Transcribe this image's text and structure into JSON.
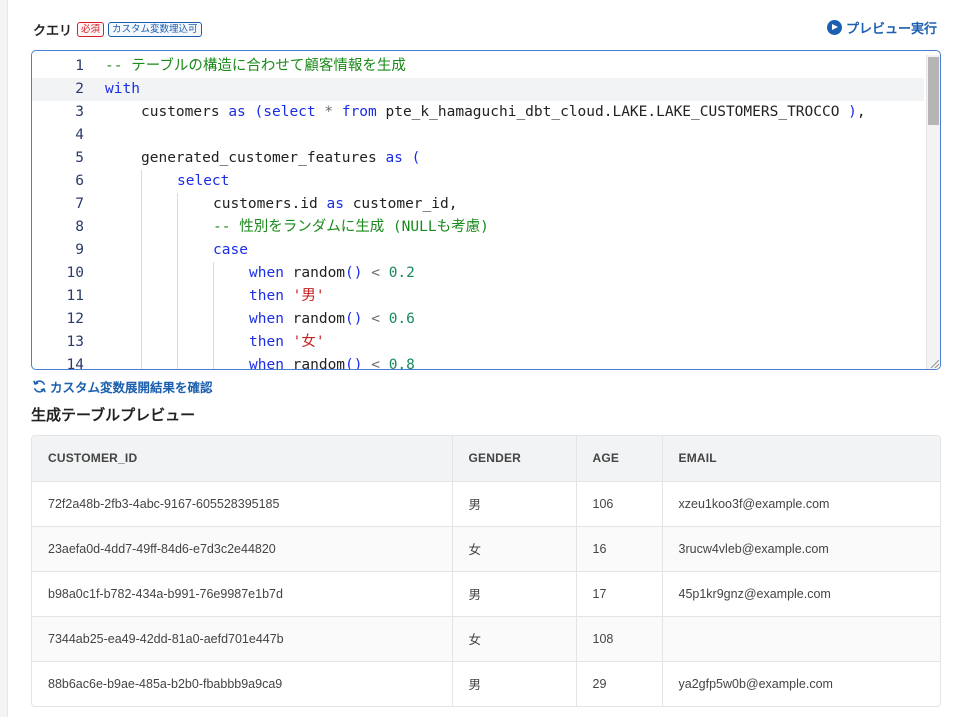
{
  "query": {
    "title": "クエリ",
    "badge_required": "必須",
    "badge_custom_vars": "カスタム変数埋込可",
    "preview_run_label": "プレビュー実行"
  },
  "editor": {
    "active_line": 2,
    "lines": [
      {
        "no": "1",
        "indent": 0,
        "tokens": [
          {
            "t": "cm",
            "v": "-- テーブルの構造に合わせて顧客情報を生成"
          }
        ]
      },
      {
        "no": "2",
        "indent": 0,
        "tokens": [
          {
            "t": "kw",
            "v": "with"
          }
        ]
      },
      {
        "no": "3",
        "indent": 1,
        "tokens": [
          {
            "t": "tx",
            "v": "customers "
          },
          {
            "t": "kw",
            "v": "as"
          },
          {
            "t": "tx",
            "v": " "
          },
          {
            "t": "par",
            "v": "("
          },
          {
            "t": "kw",
            "v": "select"
          },
          {
            "t": "tx",
            "v": " "
          },
          {
            "t": "op",
            "v": "*"
          },
          {
            "t": "tx",
            "v": " "
          },
          {
            "t": "kw",
            "v": "from"
          },
          {
            "t": "tx",
            "v": " pte_k_hamaguchi_dbt_cloud.LAKE.LAKE_CUSTOMERS_TROCCO "
          },
          {
            "t": "par",
            "v": ")"
          },
          {
            "t": "tx",
            "v": ","
          }
        ]
      },
      {
        "no": "4",
        "indent": 0,
        "tokens": []
      },
      {
        "no": "5",
        "indent": 1,
        "tokens": [
          {
            "t": "tx",
            "v": "generated_customer_features "
          },
          {
            "t": "kw",
            "v": "as"
          },
          {
            "t": "tx",
            "v": " "
          },
          {
            "t": "par",
            "v": "("
          }
        ]
      },
      {
        "no": "6",
        "indent": 2,
        "tokens": [
          {
            "t": "kw",
            "v": "select"
          }
        ]
      },
      {
        "no": "7",
        "indent": 3,
        "tokens": [
          {
            "t": "tx",
            "v": "customers.id "
          },
          {
            "t": "kw",
            "v": "as"
          },
          {
            "t": "tx",
            "v": " customer_id,"
          }
        ]
      },
      {
        "no": "8",
        "indent": 3,
        "tokens": [
          {
            "t": "cm",
            "v": "-- 性別をランダムに生成 (NULLも考慮)"
          }
        ]
      },
      {
        "no": "9",
        "indent": 3,
        "tokens": [
          {
            "t": "kw",
            "v": "case"
          }
        ]
      },
      {
        "no": "10",
        "indent": 4,
        "tokens": [
          {
            "t": "kw",
            "v": "when"
          },
          {
            "t": "tx",
            "v": " random"
          },
          {
            "t": "par",
            "v": "()"
          },
          {
            "t": "tx",
            "v": " "
          },
          {
            "t": "op",
            "v": "<"
          },
          {
            "t": "tx",
            "v": " "
          },
          {
            "t": "num",
            "v": "0.2"
          }
        ]
      },
      {
        "no": "11",
        "indent": 4,
        "tokens": [
          {
            "t": "kw",
            "v": "then"
          },
          {
            "t": "tx",
            "v": " "
          },
          {
            "t": "str",
            "v": "'男'"
          }
        ]
      },
      {
        "no": "12",
        "indent": 4,
        "tokens": [
          {
            "t": "kw",
            "v": "when"
          },
          {
            "t": "tx",
            "v": " random"
          },
          {
            "t": "par",
            "v": "()"
          },
          {
            "t": "tx",
            "v": " "
          },
          {
            "t": "op",
            "v": "<"
          },
          {
            "t": "tx",
            "v": " "
          },
          {
            "t": "num",
            "v": "0.6"
          }
        ]
      },
      {
        "no": "13",
        "indent": 4,
        "tokens": [
          {
            "t": "kw",
            "v": "then"
          },
          {
            "t": "tx",
            "v": " "
          },
          {
            "t": "str",
            "v": "'女'"
          }
        ]
      },
      {
        "no": "14",
        "indent": 4,
        "tokens": [
          {
            "t": "kw",
            "v": "when"
          },
          {
            "t": "tx",
            "v": " random"
          },
          {
            "t": "par",
            "v": "()"
          },
          {
            "t": "tx",
            "v": " "
          },
          {
            "t": "op",
            "v": "<"
          },
          {
            "t": "tx",
            "v": " "
          },
          {
            "t": "num",
            "v": "0.8"
          }
        ]
      }
    ]
  },
  "check_link_label": "カスタム変数展開結果を確認",
  "preview_section_title": "生成テーブルプレビュー",
  "preview_table": {
    "columns": [
      "CUSTOMER_ID",
      "GENDER",
      "AGE",
      "EMAIL"
    ],
    "rows": [
      [
        "72f2a48b-2fb3-4abc-9167-605528395185",
        "男",
        "106",
        "xzeu1koo3f@example.com"
      ],
      [
        "23aefa0d-4dd7-49ff-84d6-e7d3c2e44820",
        "女",
        "16",
        "3rucw4vleb@example.com"
      ],
      [
        "b98a0c1f-b782-434a-b991-76e9987e1b7d",
        "男",
        "17",
        "45p1kr9gnz@example.com"
      ],
      [
        "7344ab25-ea49-42dd-81a0-aefd701e447b",
        "女",
        "108",
        ""
      ],
      [
        "88b6ac6e-b9ae-485a-b2b0-fbabbb9a9ca9",
        "男",
        "29",
        "ya2gfp5w0b@example.com"
      ]
    ]
  },
  "icons": {
    "preview_run": "play-circle-icon",
    "check_link": "refresh-icon"
  },
  "colors": {
    "accent": "#1b5fae",
    "required": "#d6202b",
    "keyword": "#1b2de6",
    "comment": "#1a8a1a",
    "string": "#c61f1f",
    "number": "#178a5a"
  }
}
